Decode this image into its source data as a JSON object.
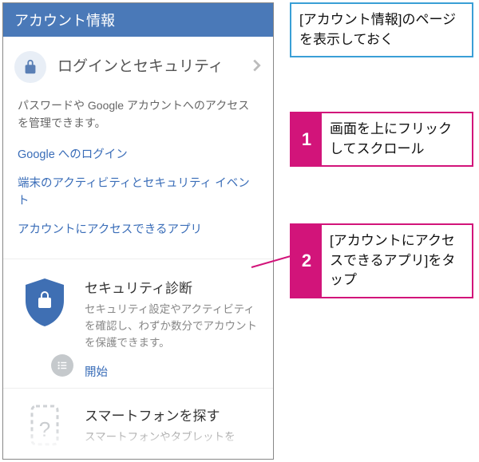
{
  "header": {
    "title": "アカウント情報"
  },
  "section_login": {
    "title": "ログインとセキュリティ",
    "desc": "パスワードや Google アカウントへのアクセスを管理できます。",
    "links": [
      "Google へのログイン",
      "端末のアクティビティとセキュリティ イベント",
      "アカウントにアクセスできるアプリ"
    ]
  },
  "card_diag": {
    "title": "セキュリティ診断",
    "body": "セキュリティ設定やアクティビティを確認し、わずか数分でアカウントを保護できます。",
    "action": "開始"
  },
  "card_find": {
    "title": "スマートフォンを探す",
    "body": "スマートフォンやタブレットを"
  },
  "notes": {
    "info": "[アカウント情報]のページを表示しておく",
    "step1_num": "1",
    "step1_txt": "画面を上にフリックしてスクロール",
    "step2_num": "2",
    "step2_txt": "[アカウントにアクセスできるアプリ]をタップ"
  }
}
